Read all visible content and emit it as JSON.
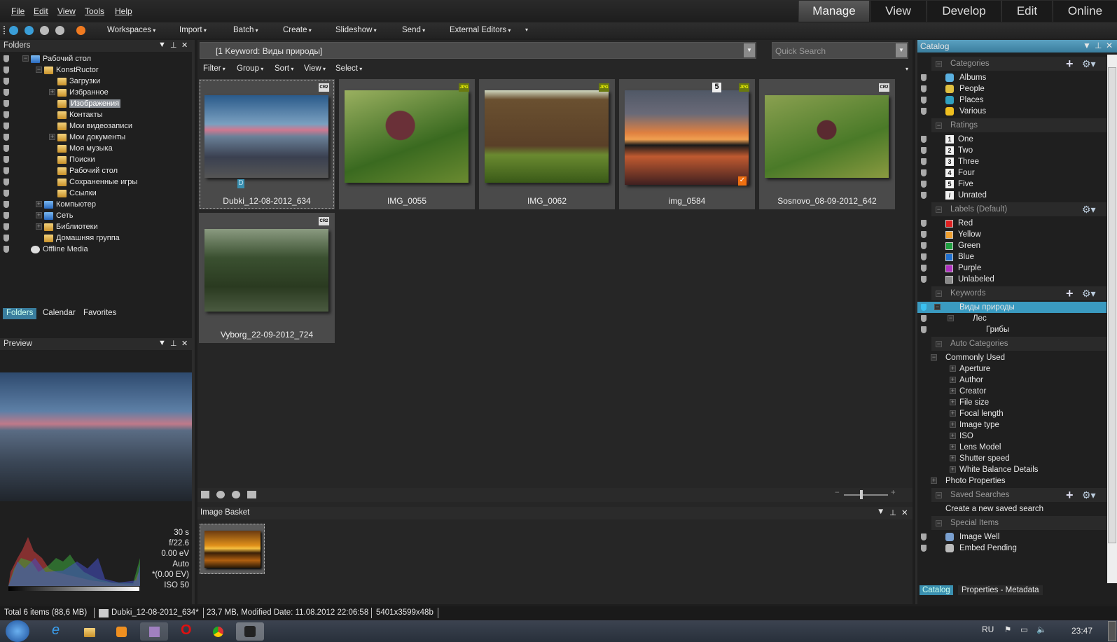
{
  "menu": [
    "File",
    "Edit",
    "View",
    "Tools",
    "Help"
  ],
  "modes": [
    {
      "label": "Manage",
      "active": true
    },
    {
      "label": "View"
    },
    {
      "label": "Develop"
    },
    {
      "label": "Edit"
    },
    {
      "label": "Online"
    }
  ],
  "toolbar": [
    "Workspaces",
    "Import",
    "Batch",
    "Create",
    "Slideshow",
    "Send",
    "External Editors"
  ],
  "folders": {
    "title": "Folders",
    "tree": [
      {
        "label": "Рабочий стол",
        "level": 0,
        "exp": "-",
        "icon": "desktop"
      },
      {
        "label": "KonstRuctor",
        "level": 1,
        "exp": "-",
        "icon": "user-folder"
      },
      {
        "label": "Загрузки",
        "level": 2
      },
      {
        "label": "Избранное",
        "level": 2,
        "exp": "+"
      },
      {
        "label": "Изображения",
        "level": 2,
        "selected": true
      },
      {
        "label": "Контакты",
        "level": 2
      },
      {
        "label": "Мои видеозаписи",
        "level": 2
      },
      {
        "label": "Мои документы",
        "level": 2,
        "exp": "+"
      },
      {
        "label": "Моя музыка",
        "level": 2
      },
      {
        "label": "Поиски",
        "level": 2
      },
      {
        "label": "Рабочий стол",
        "level": 2
      },
      {
        "label": "Сохраненные игры",
        "level": 2
      },
      {
        "label": "Ссылки",
        "level": 2
      },
      {
        "label": "Компьютер",
        "level": 1,
        "exp": "+",
        "icon": "computer"
      },
      {
        "label": "Сеть",
        "level": 1,
        "exp": "+",
        "icon": "network"
      },
      {
        "label": "Библиотеки",
        "level": 1,
        "exp": "+",
        "icon": "libraries"
      },
      {
        "label": "Домашняя группа",
        "level": 1,
        "icon": "homegroup"
      },
      {
        "label": "Offline Media",
        "level": 0,
        "icon": "offline-media"
      }
    ],
    "tabs": [
      "Folders",
      "Calendar",
      "Favorites"
    ]
  },
  "preview": {
    "title": "Preview",
    "exif": [
      "30 s",
      "f/22.6",
      "0.00 eV",
      "Auto",
      "*(0.00 EV)",
      "ISO 50"
    ]
  },
  "browser": {
    "keyword": "[1 Keyword: Виды природы]",
    "search_placeholder": "Quick Search",
    "filters": [
      "Filter",
      "Group",
      "Sort",
      "View",
      "Select"
    ],
    "thumbs": [
      {
        "name": "Dubki_12-08-2012_634",
        "format": "CR2",
        "developed": "D",
        "scene": "sea"
      },
      {
        "name": "IMG_0055",
        "format": "JPG",
        "scene": "mushroom"
      },
      {
        "name": "IMG_0062",
        "format": "JPG",
        "scene": "forest"
      },
      {
        "name": "img_0584",
        "format": "JPG",
        "rating": "5",
        "tagged": true,
        "scene": "sunset"
      },
      {
        "name": "Sosnovo_08-09-2012_642",
        "format": "CR2",
        "scene": "mushroom2"
      },
      {
        "name": "Vyborg_22-09-2012_724",
        "format": "CR2",
        "scene": "bridge"
      }
    ],
    "basket_title": "Image Basket"
  },
  "catalog": {
    "title": "Catalog",
    "rows": [
      {
        "h": "Categories",
        "tools": true
      },
      {
        "t": "Albums",
        "icon": "albums"
      },
      {
        "t": "People",
        "icon": "people"
      },
      {
        "t": "Places",
        "icon": "globe"
      },
      {
        "t": "Various",
        "icon": "flower"
      },
      {
        "h": "Ratings"
      },
      {
        "t": "One",
        "r": "1"
      },
      {
        "t": "Two",
        "r": "2"
      },
      {
        "t": "Three",
        "r": "3"
      },
      {
        "t": "Four",
        "r": "4"
      },
      {
        "t": "Five",
        "r": "5"
      },
      {
        "t": "Unrated",
        "r": "/"
      },
      {
        "h": "Labels (Default)",
        "gear": true
      },
      {
        "t": "Red",
        "c": "#e02020"
      },
      {
        "t": "Yellow",
        "c": "#f0a030"
      },
      {
        "t": "Green",
        "c": "#20a040"
      },
      {
        "t": "Blue",
        "c": "#2070d0"
      },
      {
        "t": "Purple",
        "c": "#b030c0"
      },
      {
        "t": "Unlabeled",
        "c": "#888888"
      },
      {
        "h": "Keywords",
        "tools": true
      },
      {
        "t": "Виды природы",
        "sel": true,
        "ind": 0
      },
      {
        "t": "Лес",
        "ind": 1
      },
      {
        "t": "Грибы",
        "ind": 2
      },
      {
        "h": "Auto Categories"
      },
      {
        "t": "Commonly Used",
        "ind": 0,
        "np": true
      },
      {
        "t": "Aperture",
        "ind": 1,
        "np": true
      },
      {
        "t": "Author",
        "ind": 1,
        "np": true
      },
      {
        "t": "Creator",
        "ind": 1,
        "np": true
      },
      {
        "t": "File size",
        "ind": 1,
        "np": true
      },
      {
        "t": "Focal length",
        "ind": 1,
        "np": true
      },
      {
        "t": "Image type",
        "ind": 1,
        "np": true
      },
      {
        "t": "ISO",
        "ind": 1,
        "np": true
      },
      {
        "t": "Lens Model",
        "ind": 1,
        "np": true
      },
      {
        "t": "Shutter speed",
        "ind": 1,
        "np": true
      },
      {
        "t": "White Balance Details",
        "ind": 1,
        "np": true
      },
      {
        "t": "Photo Properties",
        "ind": 0,
        "np": true
      },
      {
        "h": "Saved Searches",
        "tools": true
      },
      {
        "t": "Create a new saved search",
        "ind": 0,
        "np": true
      },
      {
        "h": "Special Items"
      },
      {
        "t": "Image Well",
        "icon": "image-well"
      },
      {
        "t": "Embed Pending",
        "icon": "embed-pending"
      }
    ],
    "tabs": [
      "Catalog",
      "Properties - Metadata"
    ]
  },
  "status": {
    "total": "Total 6 items  (88,6 MB)",
    "file": "Dubki_12-08-2012_634*",
    "info": "23,7 MB, Modified Date: 11.08.2012 22:06:58",
    "dims": "5401x3599x48b"
  },
  "taskbar": {
    "lang": "RU",
    "time": "23:47"
  }
}
